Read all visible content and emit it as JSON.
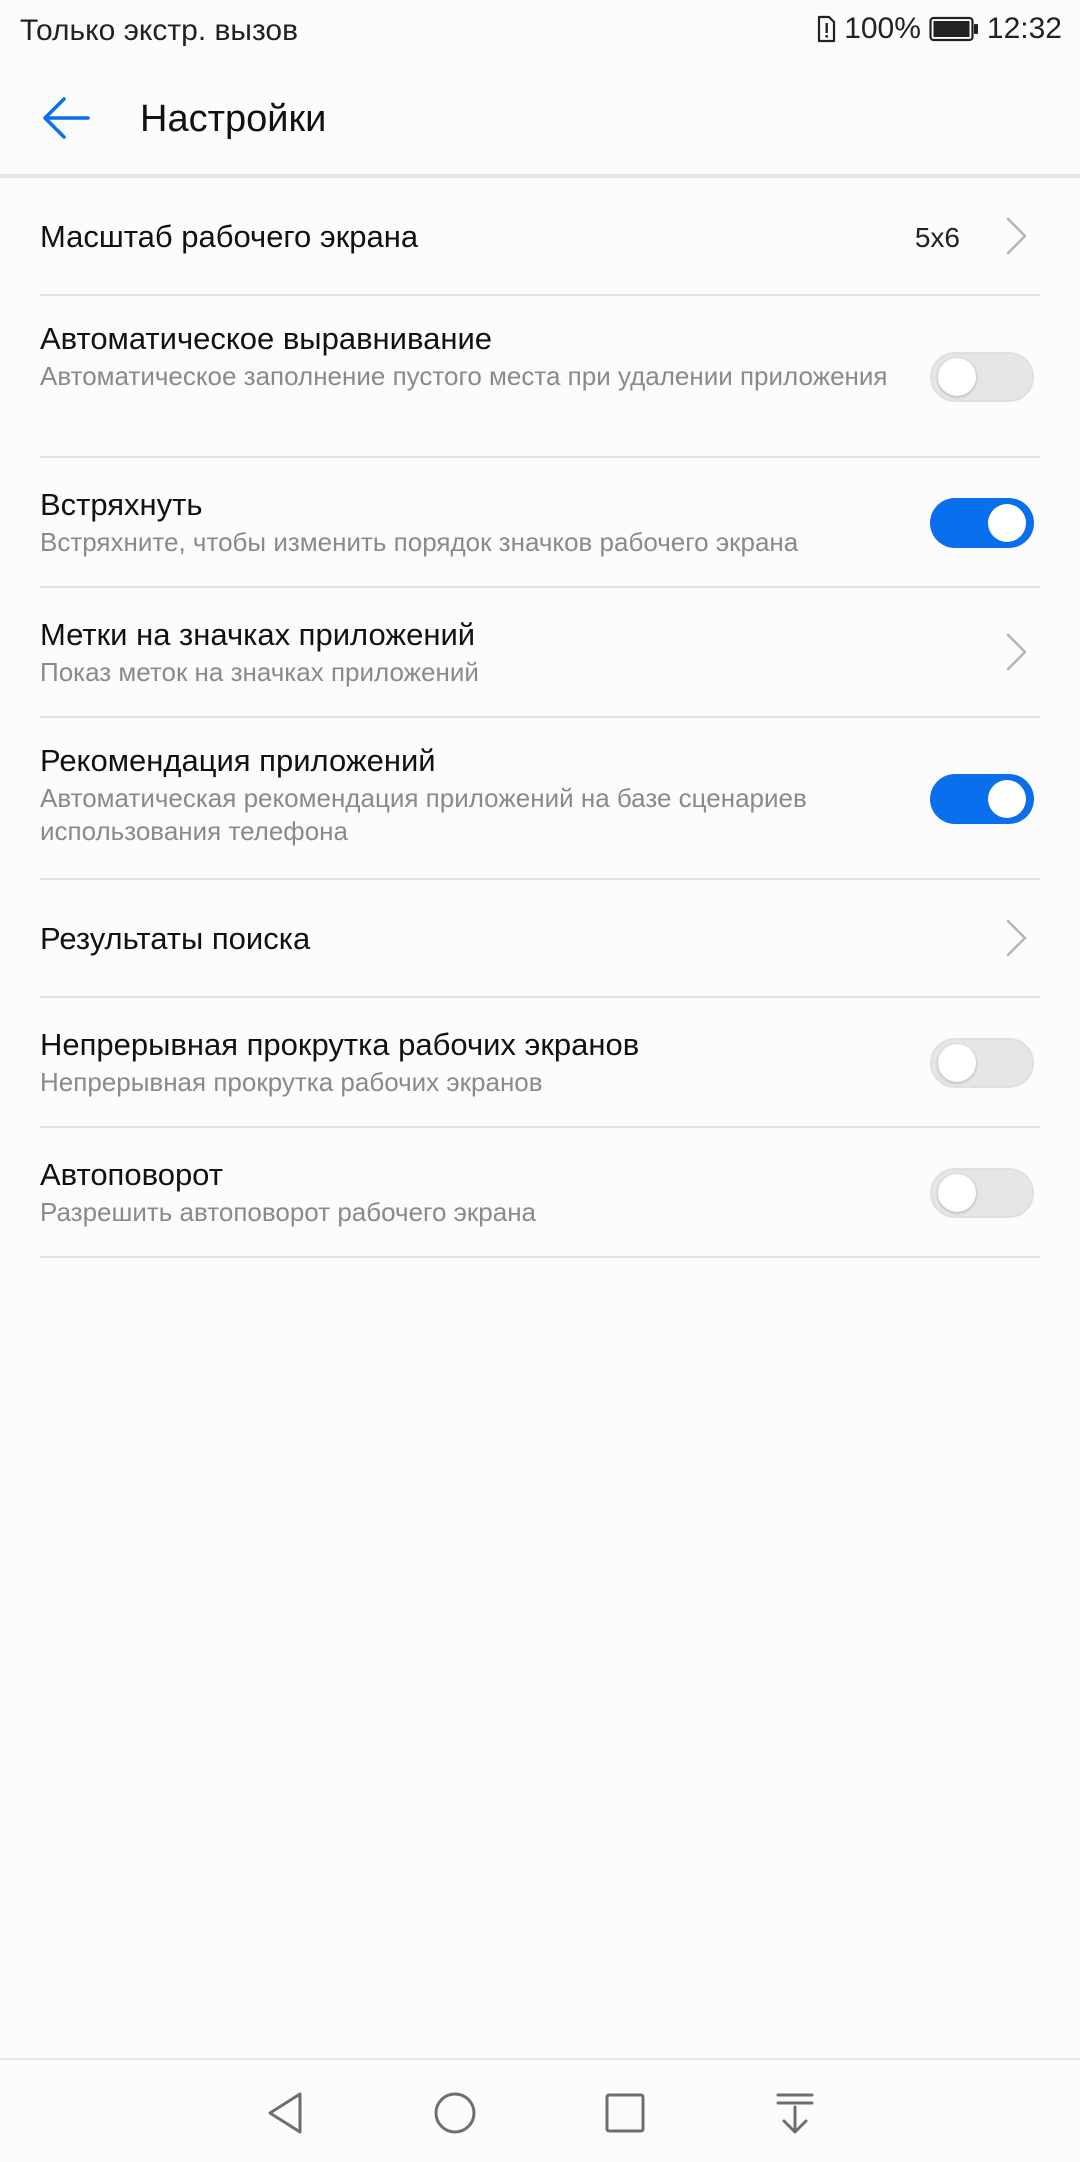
{
  "status_bar": {
    "carrier_text": "Только экстр. вызов",
    "battery_percent": "100%",
    "time": "12:32",
    "icons": [
      "sim-alert-icon",
      "battery-icon"
    ]
  },
  "header": {
    "title": "Настройки",
    "back_icon": "arrow-left-icon",
    "accent_color": "#0a6fec"
  },
  "settings": [
    {
      "id": "grid-scale",
      "title": "Масштаб рабочего экрана",
      "subtitle": "",
      "control": "chevron",
      "value": "5x6"
    },
    {
      "id": "auto-align",
      "title": "Автоматическое выравнивание",
      "subtitle": "Автоматическое заполнение пустого места при удалении приложения",
      "control": "toggle",
      "enabled": false
    },
    {
      "id": "shake",
      "title": "Встряхнуть",
      "subtitle": "Встряхните, чтобы изменить порядок значков рабочего экрана",
      "control": "toggle",
      "enabled": true
    },
    {
      "id": "app-badges",
      "title": "Метки на значках приложений",
      "subtitle": "Показ меток на значках приложений",
      "control": "chevron"
    },
    {
      "id": "app-suggestions",
      "title": "Рекомендация приложений",
      "subtitle": "Автоматическая рекомендация приложений на базе сценариев использования телефона",
      "control": "toggle",
      "enabled": true
    },
    {
      "id": "search-results",
      "title": "Результаты поиска",
      "subtitle": "",
      "control": "chevron"
    },
    {
      "id": "continuous-scroll",
      "title": "Непрерывная прокрутка рабочих экранов",
      "subtitle": "Непрерывная прокрутка рабочих экранов",
      "control": "toggle",
      "enabled": false
    },
    {
      "id": "auto-rotate",
      "title": "Автоповорот",
      "subtitle": "Разрешить автоповорот рабочего экрана",
      "control": "toggle",
      "enabled": false
    }
  ],
  "nav_bar": {
    "icons": [
      "back-triangle-icon",
      "home-circle-icon",
      "recents-square-icon",
      "notification-pull-icon"
    ]
  }
}
